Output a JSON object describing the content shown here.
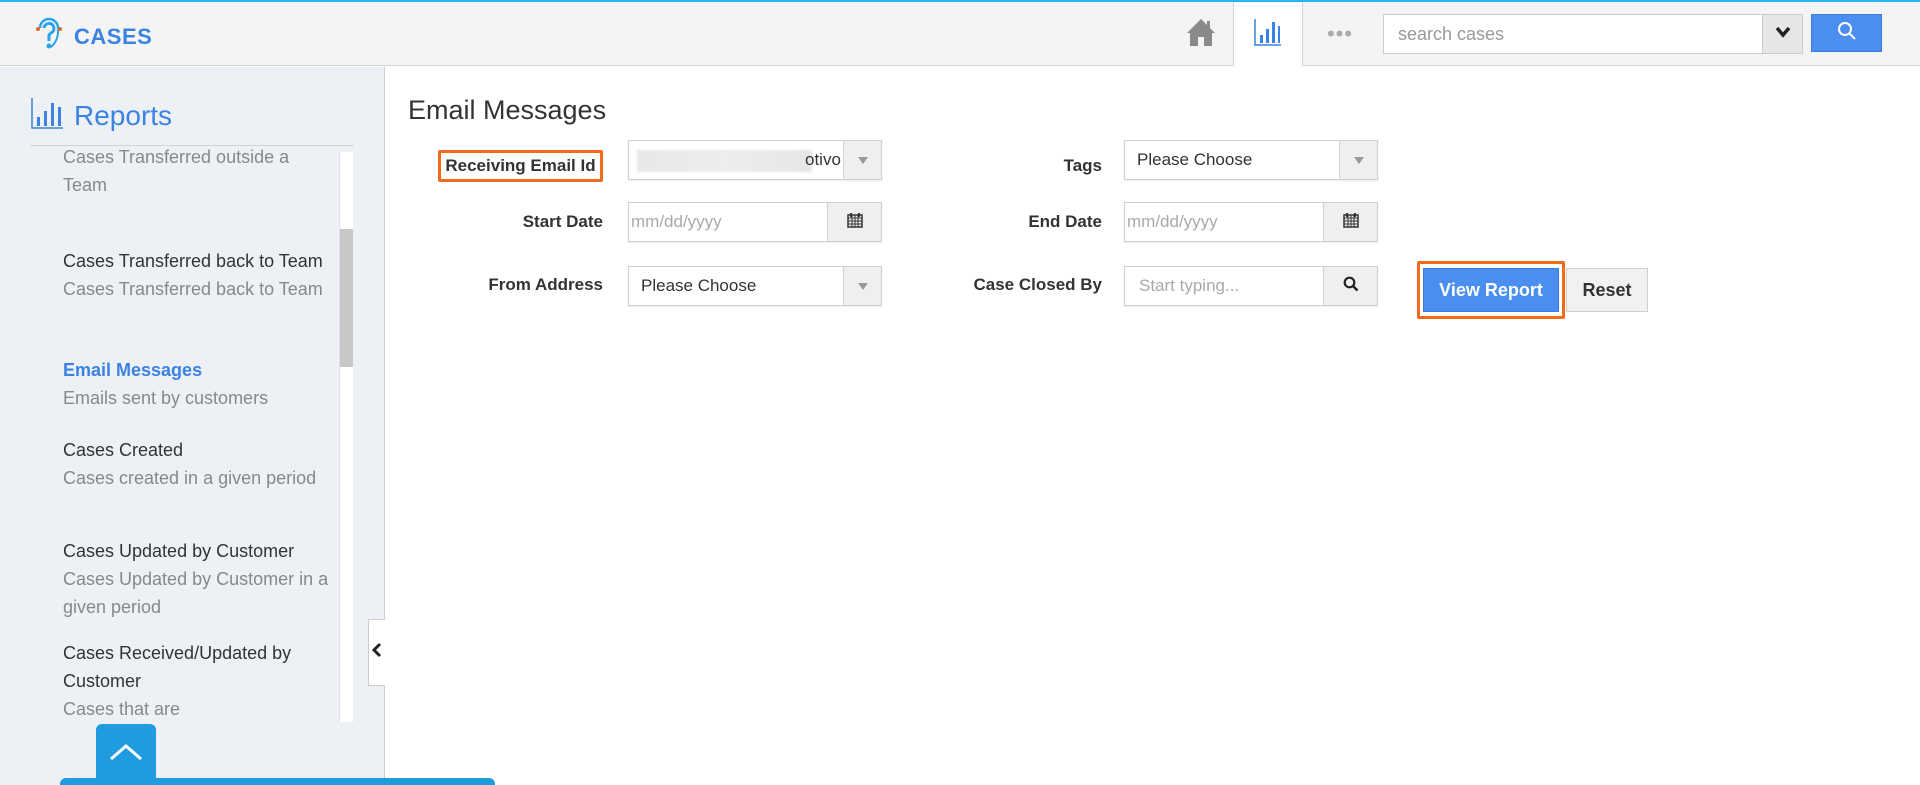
{
  "header": {
    "app_title": "CASES",
    "nav": {
      "home_label": "Home",
      "reports_label": "Reports",
      "more_label": "•••"
    },
    "search": {
      "placeholder": "search cases",
      "value": ""
    }
  },
  "sidebar": {
    "title": "Reports",
    "items": [
      {
        "title": "Team",
        "desc": "Cases Transferred outside a Team",
        "active": false,
        "partial": true
      },
      {
        "title": "Cases Transferred back to Team",
        "desc": "Cases Transferred back to Team",
        "active": false
      },
      {
        "title": "Email Messages",
        "desc": "Emails sent by customers",
        "active": true
      },
      {
        "title": "Cases Created",
        "desc": "Cases created in a given period",
        "active": false
      },
      {
        "title": "Cases Updated by Customer",
        "desc": "Cases Updated by Customer in a given period",
        "active": false
      },
      {
        "title": "Cases Received/Updated by Customer",
        "desc": "Cases that are",
        "active": false
      }
    ]
  },
  "main": {
    "title": "Email Messages",
    "form": {
      "receiving_email": {
        "label": "Receiving Email Id",
        "value": "otivo$"
      },
      "tags": {
        "label": "Tags",
        "value": "Please Choose"
      },
      "start_date": {
        "label": "Start Date",
        "placeholder": "mm/dd/yyyy"
      },
      "end_date": {
        "label": "End Date",
        "placeholder": "mm/dd/yyyy"
      },
      "from_address": {
        "label": "From Address",
        "value": "Please Choose"
      },
      "case_closed_by": {
        "label": "Case Closed By",
        "placeholder": "Start typing..."
      }
    },
    "buttons": {
      "view_report": "View Report",
      "reset": "Reset"
    }
  },
  "colors": {
    "accent": "#3b83e3",
    "primary_button": "#4a8ef0",
    "highlight": "#f26b1d",
    "sidebar_bg": "#edf0f5"
  }
}
